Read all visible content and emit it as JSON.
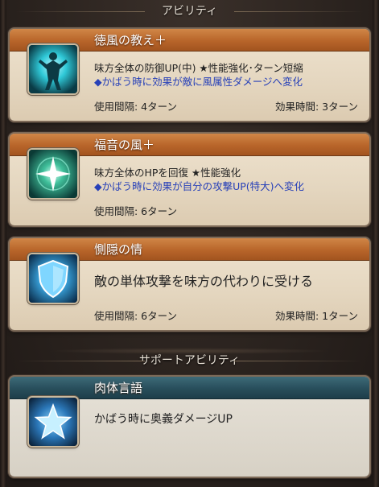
{
  "sections": {
    "abilities_header": "アビリティ",
    "support_header": "サポートアビリティ"
  },
  "abilities": [
    {
      "name": "徳風の教え＋",
      "icon": "glowing-figure-icon",
      "line1": "味方全体の防御UP(中) ★性能強化･ターン短縮",
      "line2": "◆かばう時に効果が敵に風属性ダメージへ変化",
      "cooldown": "使用間隔: 4ターン",
      "duration": "効果時間: 3ターン"
    },
    {
      "name": "福音の風＋",
      "icon": "sparkle-star-icon",
      "line1": "味方全体のHPを回復 ★性能強化",
      "line2": "◆かばう時に効果が自分の攻撃UP(特大)へ変化",
      "cooldown": "使用間隔: 6ターン"
    },
    {
      "name": "惻隠の情",
      "icon": "shield-icon",
      "line1": "敵の単体攻撃を味方の代わりに受ける",
      "cooldown": "使用間隔: 6ターン",
      "duration": "効果時間: 1ターン"
    }
  ],
  "support": [
    {
      "name": "肉体言語",
      "icon": "star-icon",
      "line1": "かばう時に奥義ダメージUP"
    }
  ],
  "colors": {
    "ability_title_bar": "#b8652a",
    "support_title_bar": "#284e5b",
    "effect_text_blue": "#2740b8",
    "card_parchment": "#e4d6bf"
  }
}
